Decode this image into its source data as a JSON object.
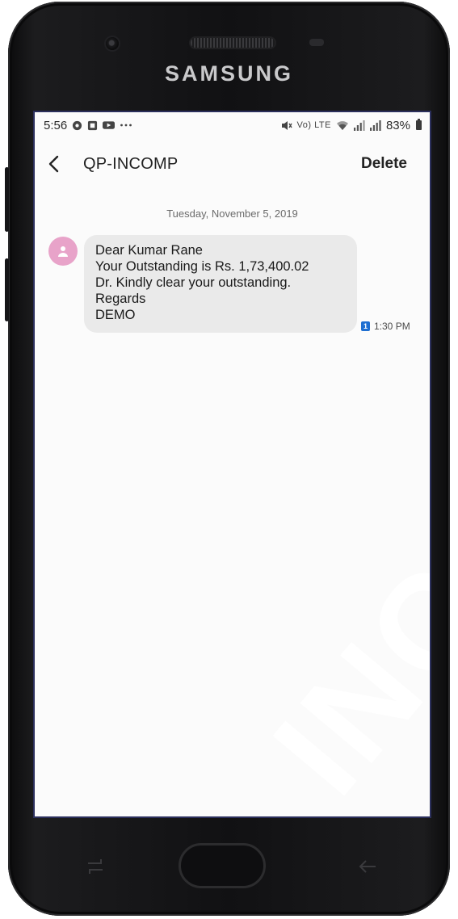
{
  "device": {
    "brand": "SAMSUNG"
  },
  "status_bar": {
    "time": "5:56",
    "network": "Vo) LTE",
    "battery": "83%"
  },
  "app_bar": {
    "title": "QP-INCOMP",
    "delete_label": "Delete"
  },
  "conversation": {
    "date_separator": "Tuesday, November 5, 2019",
    "messages": [
      {
        "lines": [
          "Dear Kumar Rane",
          "Your Outstanding is Rs. 1,73,400.02",
          "Dr. Kindly clear your outstanding.",
          "Regards",
          "DEMO"
        ],
        "sim": "1",
        "time": "1:30 PM"
      }
    ]
  },
  "watermark": {
    "text": "INC"
  },
  "colors": {
    "avatar": "#e8a3c9",
    "bubble": "#eaeaea",
    "sim_badge": "#1f6fd1",
    "screen_bg": "#fbfbfb"
  }
}
